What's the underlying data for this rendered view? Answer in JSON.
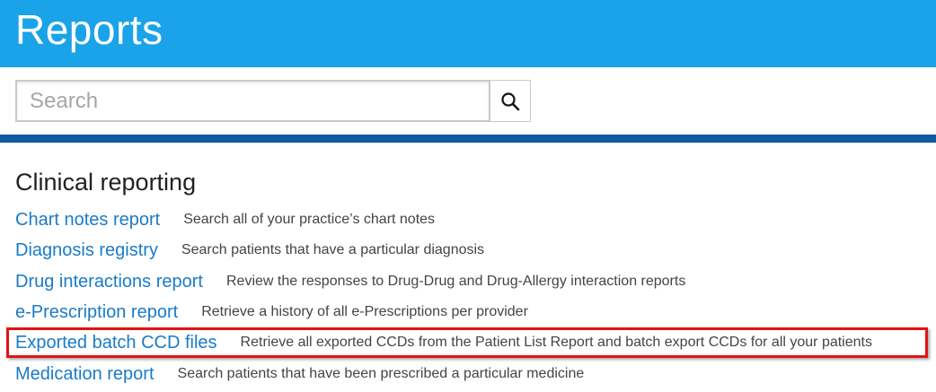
{
  "header": {
    "title": "Reports"
  },
  "search": {
    "placeholder": "Search",
    "button_icon": "search-icon"
  },
  "section": {
    "title": "Clinical reporting"
  },
  "reports": [
    {
      "label": "Chart notes report",
      "description": "Search all of your practice’s chart notes"
    },
    {
      "label": "Diagnosis registry",
      "description": "Search patients that have a particular diagnosis"
    },
    {
      "label": "Drug interactions report",
      "description": "Review the responses to Drug-Drug and Drug-Allergy interaction reports"
    },
    {
      "label": "e-Prescription report",
      "description": "Retrieve a history of all e-Prescriptions per provider"
    },
    {
      "label": "Exported batch CCD files",
      "description": "Retrieve all exported CCDs from the Patient List Report and batch export CCDs for all your patients"
    },
    {
      "label": "Medication report",
      "description": "Search patients that have been prescribed a particular medicine"
    }
  ],
  "colors": {
    "header_bg": "#1aa3e8",
    "nav_bar": "#0f5aa1",
    "link": "#1a7bc7",
    "highlight": "#e01414"
  }
}
